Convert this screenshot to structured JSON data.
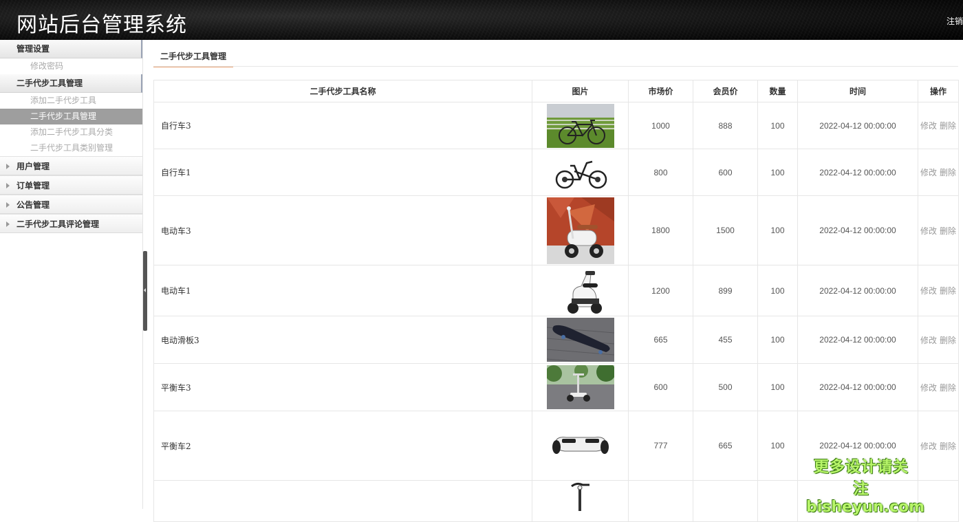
{
  "header": {
    "title": "网站后台管理系统",
    "logout_label": "注销"
  },
  "sidebar": {
    "group1": {
      "label": "管理设置",
      "items": [
        "修改密码"
      ]
    },
    "group2": {
      "label": "二手代步工具管理",
      "items": [
        "添加二手代步工具",
        "二手代步工具管理",
        "添加二手代步工具分类",
        "二手代步工具类别管理"
      ],
      "active_index": 1
    },
    "collapsed": [
      "用户管理",
      "订单管理",
      "公告管理",
      "二手代步工具评论管理"
    ]
  },
  "main": {
    "page_title": "二手代步工具管理",
    "columns": [
      "二手代步工具名称",
      "图片",
      "市场价",
      "会员价",
      "数量",
      "时间",
      "操作"
    ],
    "edit_label": "修改",
    "delete_label": "删除",
    "rows": [
      {
        "name": "自行车3",
        "image": "road-bike-photo",
        "market": "1000",
        "member": "888",
        "qty": "100",
        "time": "2022-04-12 00:00:00"
      },
      {
        "name": "自行车1",
        "image": "folding-bike-photo",
        "market": "800",
        "member": "600",
        "qty": "100",
        "time": "2022-04-12 00:00:00"
      },
      {
        "name": "电动车3",
        "image": "e-scooter-photo",
        "market": "1800",
        "member": "1500",
        "qty": "100",
        "time": "2022-04-12 00:00:00"
      },
      {
        "name": "电动车1",
        "image": "moped-photo",
        "market": "1200",
        "member": "899",
        "qty": "100",
        "time": "2022-04-12 00:00:00"
      },
      {
        "name": "电动滑板3",
        "image": "skateboard-photo",
        "market": "665",
        "member": "455",
        "qty": "100",
        "time": "2022-04-12 00:00:00"
      },
      {
        "name": "平衡车3",
        "image": "balance-scooter-photo",
        "market": "600",
        "member": "500",
        "qty": "100",
        "time": "2022-04-12 00:00:00"
      },
      {
        "name": "平衡车2",
        "image": "hoverboard-photo",
        "market": "777",
        "member": "665",
        "qty": "100",
        "time": "2022-04-12 00:00:00"
      },
      {
        "name": "",
        "image": "segway-photo",
        "market": "",
        "member": "",
        "qty": "",
        "time": ""
      }
    ]
  },
  "watermark": {
    "line1": "更多设计请关注",
    "line2": "bisheyun.com"
  }
}
